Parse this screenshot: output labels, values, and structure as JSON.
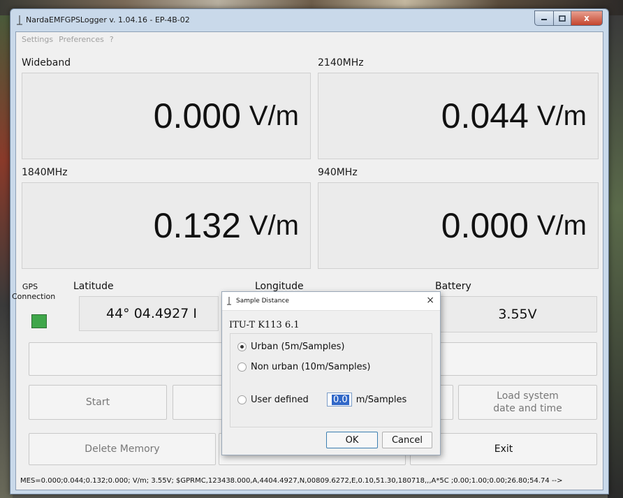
{
  "window": {
    "title": "NardaEMFGPSLogger v. 1.04.16 - EP-4B-02",
    "close_glyph": "x"
  },
  "menu": [
    "Settings",
    "Preferences",
    "?"
  ],
  "meters": [
    {
      "label": "Wideband",
      "value": "0.000",
      "unit": "V/m"
    },
    {
      "label": "2140MHz",
      "value": "0.044",
      "unit": "V/m"
    },
    {
      "label": "1840MHz",
      "value": "0.132",
      "unit": "V/m"
    },
    {
      "label": "940MHz",
      "value": "0.000",
      "unit": "V/m"
    }
  ],
  "gps": {
    "connection_label_1": "GPS",
    "connection_label_2": "Connection",
    "led_color": "#3fa64a",
    "latitude_label": "Latitude",
    "latitude_value": "44° 04.4927 I",
    "longitude_label": "Longitude",
    "battery_label": "Battery",
    "battery_value": "3.55V"
  },
  "buttons": {
    "start": "Start",
    "load_system_1": "Load system",
    "load_system_2": "date and time",
    "delete_memory": "Delete Memory",
    "exit": "Exit"
  },
  "status_line": "MES=0.000;0.044;0.132;0.000; V/m; 3.55V; $GPRMC,123438.000,A,4404.4927,N,00809.6272,E,0.10,51.30,180718,,,A*5C ;0.00;1.00;0.00;26.80;54.74 -->",
  "dialog": {
    "title": "Sample Distance",
    "close_glyph": "×",
    "heading": "ITU-T K113  6.1",
    "options": [
      {
        "label": "Urban (5m/Samples)",
        "selected": true
      },
      {
        "label": "Non urban (10m/Samples)",
        "selected": false
      },
      {
        "label": "User defined",
        "selected": false
      }
    ],
    "user_value": "0.0",
    "user_unit": "m/Samples",
    "ok": "OK",
    "cancel": "Cancel"
  }
}
